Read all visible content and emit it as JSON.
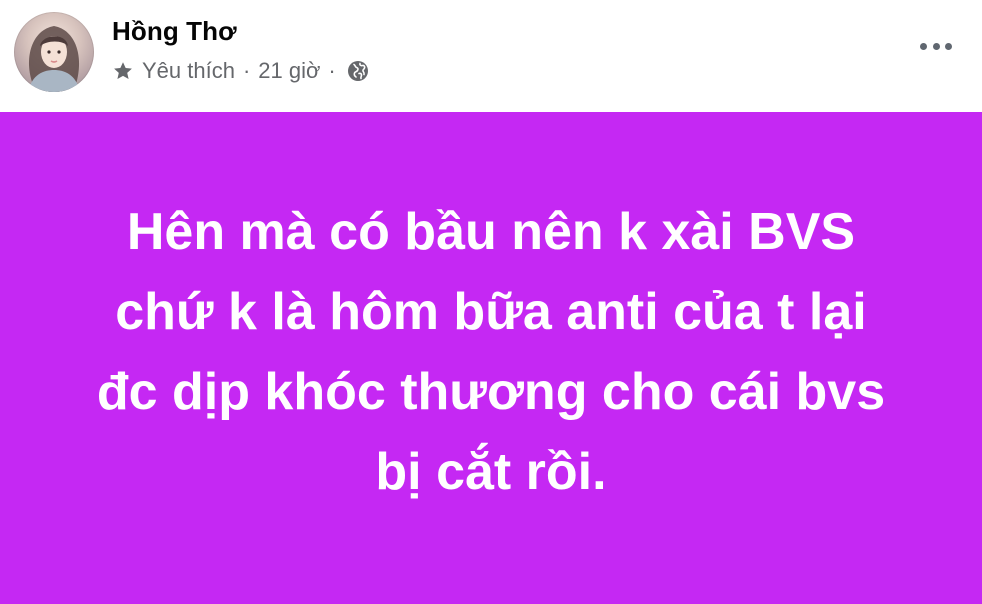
{
  "post": {
    "author": "Hồng Thơ",
    "meta": {
      "badge_icon": "star-icon",
      "badge_label": "Yêu thích",
      "separator": "·",
      "time": "21 giờ",
      "privacy_icon": "globe-icon"
    },
    "more_icon": "more-horizontal-icon",
    "background_color": "#c528f3",
    "text_lines": [
      "Hên mà có bầu nên k xài BVS",
      "chứ k là hôm bữa anti của t lại",
      "đc dịp khóc thương cho cái bvs",
      "bị cắt rồi."
    ]
  }
}
